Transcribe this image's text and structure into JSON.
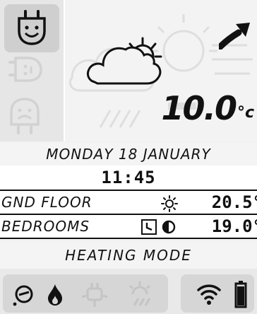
{
  "weather": {
    "temperature": "10.0",
    "unit": "°c",
    "icon": "partly-sunny-cloud-icon"
  },
  "plug": {
    "icon": "plug-smile-icon"
  },
  "datetime": {
    "date": "MONDAY 18 JANUARY",
    "time": "11:45"
  },
  "zones": [
    {
      "name": "GND FLOOR",
      "icons": [
        "sun-icon"
      ],
      "temp": "20.5°"
    },
    {
      "name": "BEDROOMS",
      "icons": [
        "timer-icon",
        "half-moon-icon"
      ],
      "temp": "19.0°"
    }
  ],
  "mode": {
    "label": "HEATING MODE"
  },
  "bottom": {
    "icons": [
      "pressure-gauge-icon",
      "flame-icon",
      "plug-faded-icon",
      "sun-faded-icon",
      "wifi-icon",
      "battery-icon"
    ]
  }
}
